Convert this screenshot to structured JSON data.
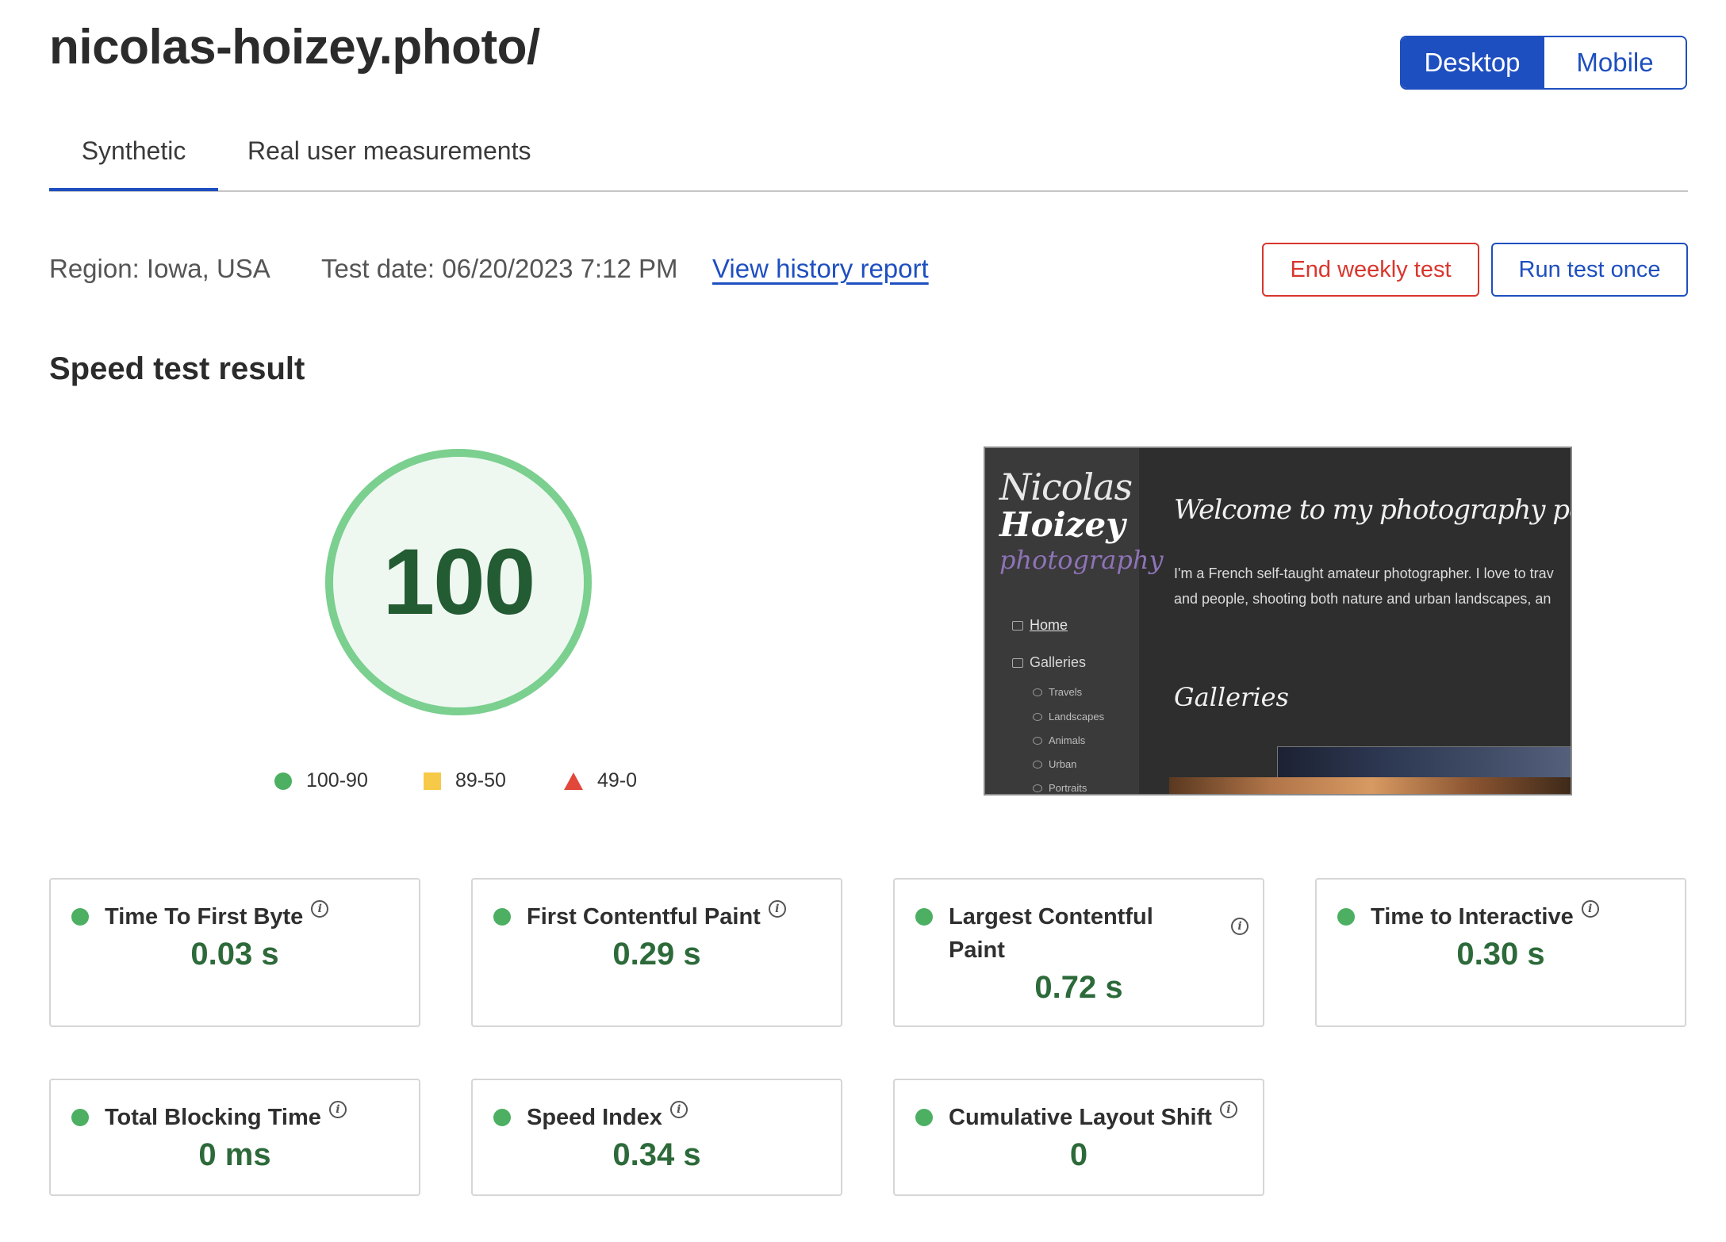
{
  "header": {
    "site_title": "nicolas-hoizey.photo/",
    "device_toggle": {
      "desktop": "Desktop",
      "mobile": "Mobile",
      "selected": "Desktop"
    }
  },
  "tabs": [
    {
      "label": "Synthetic",
      "active": true
    },
    {
      "label": "Real user measurements",
      "active": false
    }
  ],
  "meta": {
    "region": "Region: Iowa, USA",
    "test_date": "Test date: 06/20/2023 7:12 PM",
    "history_link": "View history report",
    "end_button": "End weekly test",
    "run_button": "Run test once"
  },
  "section_heading": "Speed test result",
  "score": {
    "value": "100",
    "legend": [
      {
        "label": "100-90",
        "shape": "circle",
        "color": "#4caf62"
      },
      {
        "label": "89-50",
        "shape": "square",
        "color": "#f7c948"
      },
      {
        "label": "49-0",
        "shape": "triangle",
        "color": "#e2483a"
      }
    ]
  },
  "preview": {
    "name_line1": "Nicolas",
    "name_line2": "Hoizey",
    "name_line3": "photography",
    "nav_home": "Home",
    "nav_galleries": "Galleries",
    "subnav": [
      "Travels",
      "Landscapes",
      "Animals",
      "Urban",
      "Portraits"
    ],
    "welcome": "Welcome to my photography portfolio",
    "text_line1": "I'm a French self-taught amateur photographer. I love to trav",
    "text_line2": "and people, shooting both nature and urban landscapes, an",
    "galleries_heading": "Galleries"
  },
  "metrics": [
    {
      "label": "Time To First Byte",
      "value": "0.03 s",
      "status": "good"
    },
    {
      "label": "First Contentful Paint",
      "value": "0.29 s",
      "status": "good"
    },
    {
      "label": "Largest Contentful Paint",
      "value": "0.72 s",
      "status": "good"
    },
    {
      "label": "Time to Interactive",
      "value": "0.30 s",
      "status": "good"
    },
    {
      "label": "Total Blocking Time",
      "value": "0 ms",
      "status": "good"
    },
    {
      "label": "Speed Index",
      "value": "0.34 s",
      "status": "good"
    },
    {
      "label": "Cumulative Layout Shift",
      "value": "0",
      "status": "good"
    }
  ],
  "info_icon_glyph": "i",
  "colors": {
    "accent": "#1e4fc0",
    "danger": "#d9362c",
    "good": "#4caf62",
    "good_text": "#2d6a3a",
    "score_ring": "#7bcf8f"
  }
}
